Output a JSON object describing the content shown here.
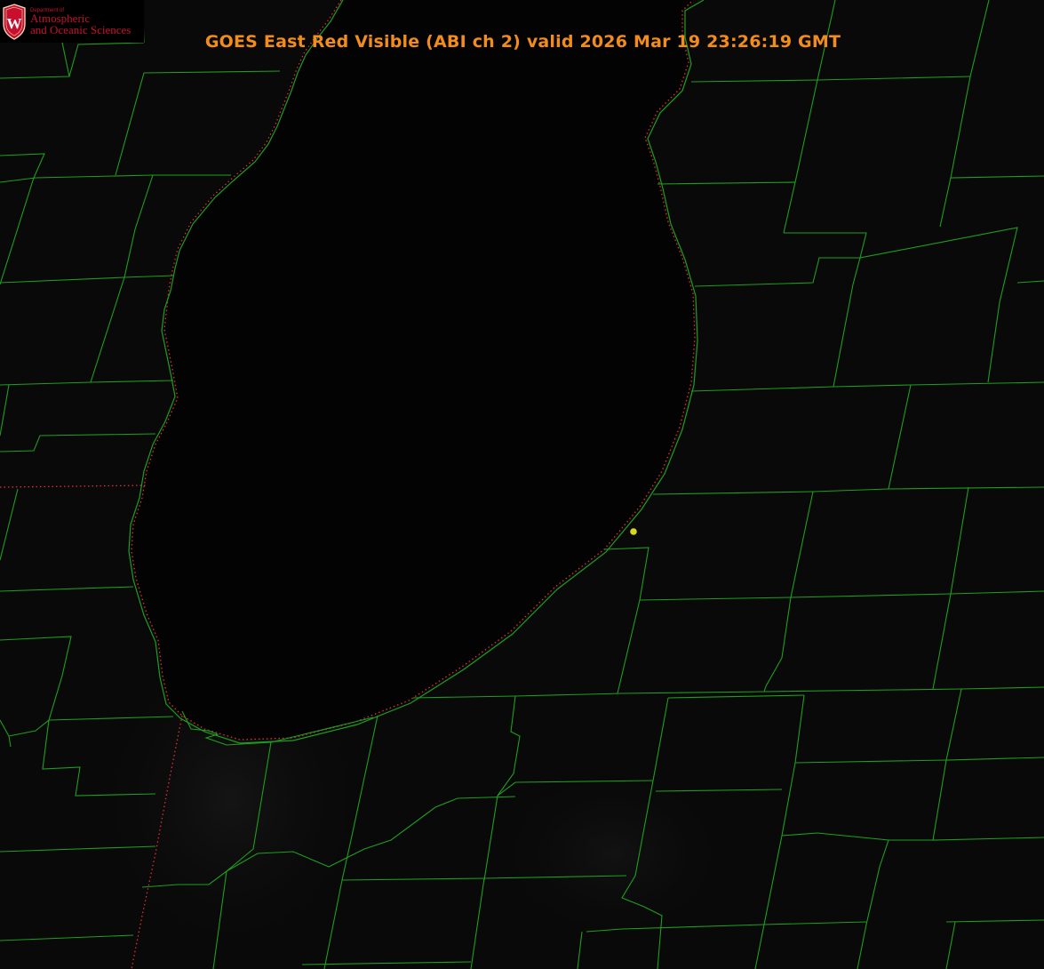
{
  "title": "GOES East Red Visible (ABI ch 2) valid 2026 Mar 19 23:26:19 GMT",
  "logo": {
    "dept": "Department of",
    "line1": "Atmospheric",
    "line2": "and Oceanic Sciences",
    "seal_letter": "W"
  },
  "colors": {
    "background": "#000000",
    "lake": "#030303",
    "county_lines": "#1e9e1e",
    "state_border": "#e03030",
    "title": "#f28c1a",
    "logo_red": "#c8102e",
    "marker": "#d8d820"
  },
  "icons": {
    "seal": "uw-crest-icon",
    "marker": "location-dot-icon"
  }
}
